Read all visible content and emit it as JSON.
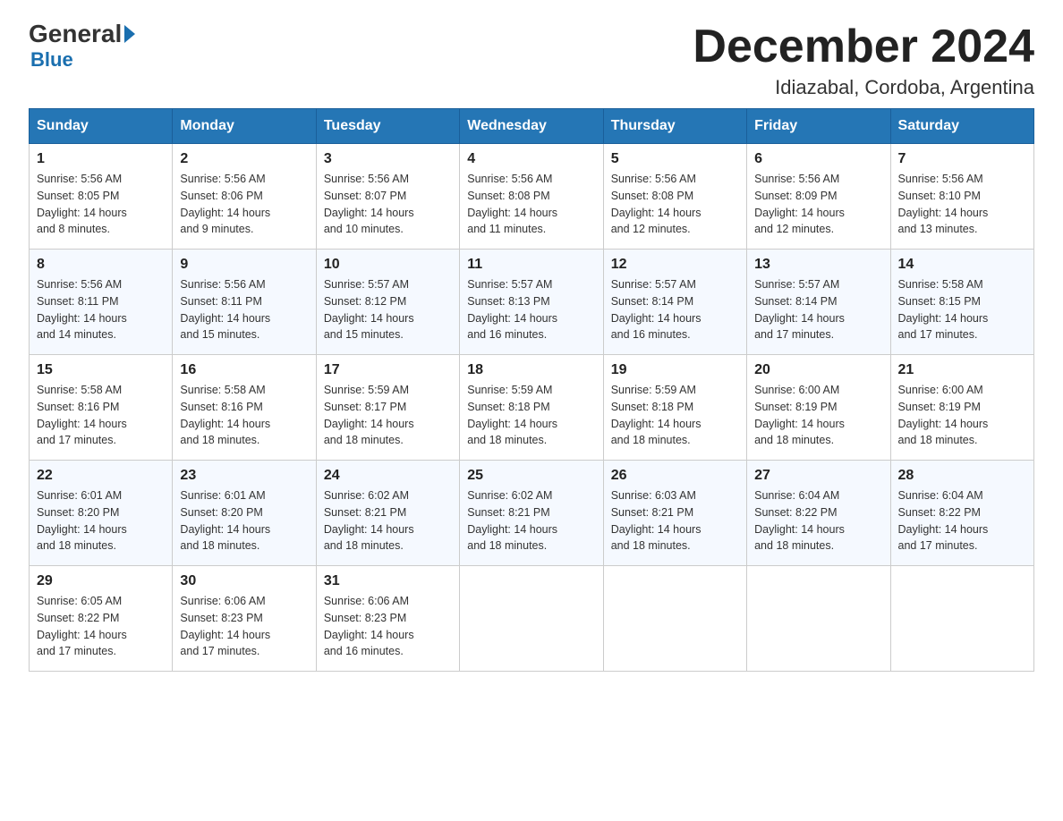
{
  "logo": {
    "general": "General",
    "blue": "Blue"
  },
  "title": "December 2024",
  "subtitle": "Idiazabal, Cordoba, Argentina",
  "days_of_week": [
    "Sunday",
    "Monday",
    "Tuesday",
    "Wednesday",
    "Thursday",
    "Friday",
    "Saturday"
  ],
  "weeks": [
    [
      {
        "day": "1",
        "sunrise": "5:56 AM",
        "sunset": "8:05 PM",
        "daylight": "14 hours and 8 minutes."
      },
      {
        "day": "2",
        "sunrise": "5:56 AM",
        "sunset": "8:06 PM",
        "daylight": "14 hours and 9 minutes."
      },
      {
        "day": "3",
        "sunrise": "5:56 AM",
        "sunset": "8:07 PM",
        "daylight": "14 hours and 10 minutes."
      },
      {
        "day": "4",
        "sunrise": "5:56 AM",
        "sunset": "8:08 PM",
        "daylight": "14 hours and 11 minutes."
      },
      {
        "day": "5",
        "sunrise": "5:56 AM",
        "sunset": "8:08 PM",
        "daylight": "14 hours and 12 minutes."
      },
      {
        "day": "6",
        "sunrise": "5:56 AM",
        "sunset": "8:09 PM",
        "daylight": "14 hours and 12 minutes."
      },
      {
        "day": "7",
        "sunrise": "5:56 AM",
        "sunset": "8:10 PM",
        "daylight": "14 hours and 13 minutes."
      }
    ],
    [
      {
        "day": "8",
        "sunrise": "5:56 AM",
        "sunset": "8:11 PM",
        "daylight": "14 hours and 14 minutes."
      },
      {
        "day": "9",
        "sunrise": "5:56 AM",
        "sunset": "8:11 PM",
        "daylight": "14 hours and 15 minutes."
      },
      {
        "day": "10",
        "sunrise": "5:57 AM",
        "sunset": "8:12 PM",
        "daylight": "14 hours and 15 minutes."
      },
      {
        "day": "11",
        "sunrise": "5:57 AM",
        "sunset": "8:13 PM",
        "daylight": "14 hours and 16 minutes."
      },
      {
        "day": "12",
        "sunrise": "5:57 AM",
        "sunset": "8:14 PM",
        "daylight": "14 hours and 16 minutes."
      },
      {
        "day": "13",
        "sunrise": "5:57 AM",
        "sunset": "8:14 PM",
        "daylight": "14 hours and 17 minutes."
      },
      {
        "day": "14",
        "sunrise": "5:58 AM",
        "sunset": "8:15 PM",
        "daylight": "14 hours and 17 minutes."
      }
    ],
    [
      {
        "day": "15",
        "sunrise": "5:58 AM",
        "sunset": "8:16 PM",
        "daylight": "14 hours and 17 minutes."
      },
      {
        "day": "16",
        "sunrise": "5:58 AM",
        "sunset": "8:16 PM",
        "daylight": "14 hours and 18 minutes."
      },
      {
        "day": "17",
        "sunrise": "5:59 AM",
        "sunset": "8:17 PM",
        "daylight": "14 hours and 18 minutes."
      },
      {
        "day": "18",
        "sunrise": "5:59 AM",
        "sunset": "8:18 PM",
        "daylight": "14 hours and 18 minutes."
      },
      {
        "day": "19",
        "sunrise": "5:59 AM",
        "sunset": "8:18 PM",
        "daylight": "14 hours and 18 minutes."
      },
      {
        "day": "20",
        "sunrise": "6:00 AM",
        "sunset": "8:19 PM",
        "daylight": "14 hours and 18 minutes."
      },
      {
        "day": "21",
        "sunrise": "6:00 AM",
        "sunset": "8:19 PM",
        "daylight": "14 hours and 18 minutes."
      }
    ],
    [
      {
        "day": "22",
        "sunrise": "6:01 AM",
        "sunset": "8:20 PM",
        "daylight": "14 hours and 18 minutes."
      },
      {
        "day": "23",
        "sunrise": "6:01 AM",
        "sunset": "8:20 PM",
        "daylight": "14 hours and 18 minutes."
      },
      {
        "day": "24",
        "sunrise": "6:02 AM",
        "sunset": "8:21 PM",
        "daylight": "14 hours and 18 minutes."
      },
      {
        "day": "25",
        "sunrise": "6:02 AM",
        "sunset": "8:21 PM",
        "daylight": "14 hours and 18 minutes."
      },
      {
        "day": "26",
        "sunrise": "6:03 AM",
        "sunset": "8:21 PM",
        "daylight": "14 hours and 18 minutes."
      },
      {
        "day": "27",
        "sunrise": "6:04 AM",
        "sunset": "8:22 PM",
        "daylight": "14 hours and 18 minutes."
      },
      {
        "day": "28",
        "sunrise": "6:04 AM",
        "sunset": "8:22 PM",
        "daylight": "14 hours and 17 minutes."
      }
    ],
    [
      {
        "day": "29",
        "sunrise": "6:05 AM",
        "sunset": "8:22 PM",
        "daylight": "14 hours and 17 minutes."
      },
      {
        "day": "30",
        "sunrise": "6:06 AM",
        "sunset": "8:23 PM",
        "daylight": "14 hours and 17 minutes."
      },
      {
        "day": "31",
        "sunrise": "6:06 AM",
        "sunset": "8:23 PM",
        "daylight": "14 hours and 16 minutes."
      },
      null,
      null,
      null,
      null
    ]
  ],
  "labels": {
    "sunrise": "Sunrise:",
    "sunset": "Sunset:",
    "daylight": "Daylight:"
  }
}
